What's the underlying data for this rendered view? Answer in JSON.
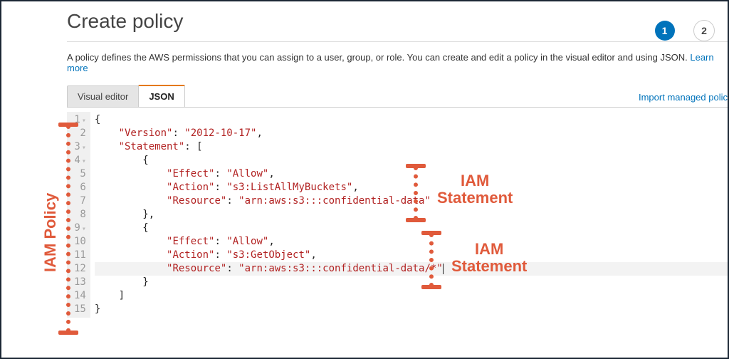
{
  "title": "Create policy",
  "steps": {
    "current": "1",
    "next": "2"
  },
  "description": "A policy defines the AWS permissions that you can assign to a user, group, or role. You can create and edit a policy in the visual editor and using JSON. ",
  "learn_more": "Learn more",
  "tabs": {
    "visual": "Visual editor",
    "json": "JSON"
  },
  "import_link": "Import managed polic",
  "code": {
    "line1": "{",
    "line2_key": "\"Version\"",
    "line2_val": "\"2012-10-17\"",
    "line3_key": "\"Statement\"",
    "line3_open": ": [",
    "line4": "{",
    "line5_key": "\"Effect\"",
    "line5_val": "\"Allow\"",
    "line6_key": "\"Action\"",
    "line6_val": "\"s3:ListAllMyBuckets\"",
    "line7_key": "\"Resource\"",
    "line7_val": "\"arn:aws:s3:::confidential-data\"",
    "line8": "},",
    "line9": "{",
    "line10_key": "\"Effect\"",
    "line10_val": "\"Allow\"",
    "line11_key": "\"Action\"",
    "line11_val": "\"s3:GetObject\"",
    "line12_key": "\"Resource\"",
    "line12_val": "\"arn:aws:s3:::confidential-data/*\"",
    "line13": "}",
    "line14": "]",
    "line15": "}"
  },
  "gutter": [
    "1",
    "2",
    "3",
    "4",
    "5",
    "6",
    "7",
    "8",
    "9",
    "10",
    "11",
    "12",
    "13",
    "14",
    "15"
  ],
  "anno": {
    "policy_label": "IAM Policy",
    "stmt_line1": "IAM",
    "stmt_line2": "Statement"
  }
}
